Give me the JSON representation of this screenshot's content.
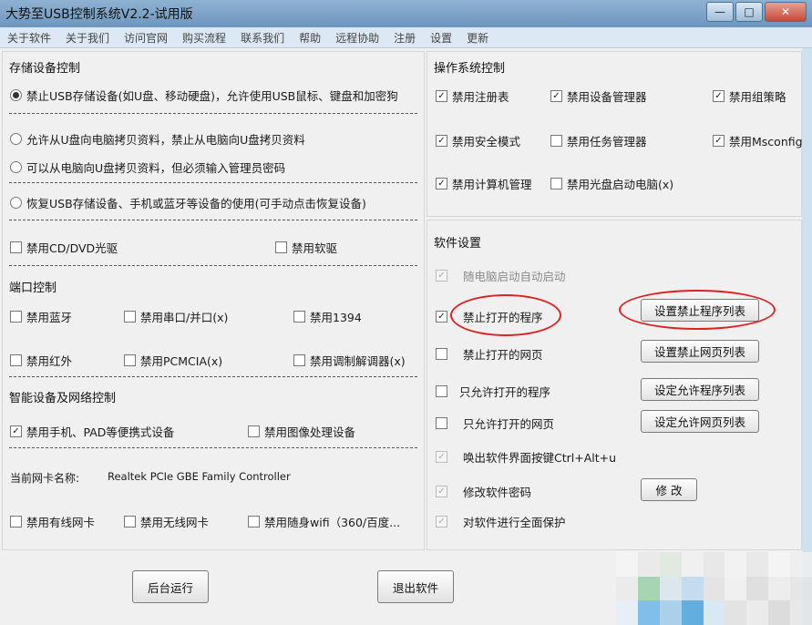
{
  "window": {
    "title": "大势至USB控制系统V2.2-试用版",
    "minimize_glyph": "—",
    "maximize_glyph": "□",
    "close_glyph": "✕"
  },
  "menu": [
    "关于软件",
    "关于我们",
    "访问官网",
    "购买流程",
    "联系我们",
    "帮助",
    "远程协助",
    "注册",
    "设置",
    "更新"
  ],
  "storage": {
    "heading": "存储设备控制",
    "radio_block": "禁止USB存储设备(如U盘、移动硬盘)，允许使用USB鼠标、键盘和加密狗",
    "radio_copy_in": "允许从U盘向电脑拷贝资料，禁止从电脑向U盘拷贝资料",
    "radio_password": "可以从电脑向U盘拷贝资料，但必须输入管理员密码",
    "radio_restore": "恢复USB存储设备、手机或蓝牙等设备的使用(可手动点击恢复设备)",
    "cd_dvd": "禁用CD/DVD光驱",
    "floppy": "禁用软驱"
  },
  "ports": {
    "heading": "端口控制",
    "bluetooth": "禁用蓝牙",
    "serial": "禁用串口/并口(x)",
    "ieee1394": "禁用1394",
    "infrared": "禁用红外",
    "pcmcia": "禁用PCMCIA(x)",
    "modem": "禁用调制解调器(x)"
  },
  "network": {
    "heading": "智能设备及网络控制",
    "portable": "禁用手机、PAD等便携式设备",
    "imaging": "禁用图像处理设备",
    "nic_label": "当前网卡名称:",
    "nic_value": "Realtek PCIe GBE Family Controller",
    "wired": "禁用有线网卡",
    "wireless": "禁用无线网卡",
    "portable_wifi": "禁用随身wifi（360/百度..."
  },
  "os": {
    "heading": "操作系统控制",
    "registry": "禁用注册表",
    "device_manager": "禁用设备管理器",
    "group_policy": "禁用组策略",
    "safe_mode": "禁用安全模式",
    "task_manager": "禁用任务管理器",
    "msconfig": "禁用Msconfig",
    "computer_mgmt": "禁用计算机管理",
    "cd_boot": "禁用光盘启动电脑(x)"
  },
  "software": {
    "heading": "软件设置",
    "autostart": "随电脑启动自动启动",
    "block_programs": "禁止打开的程序",
    "block_programs_btn": "设置禁止程序列表",
    "block_sites": "禁止打开的网页",
    "block_sites_btn": "设置禁止网页列表",
    "allow_programs": "只允许打开的程序",
    "allow_programs_btn": "设定允许程序列表",
    "allow_sites": "只允许打开的网页",
    "allow_sites_btn": "设定允许网页列表",
    "hotkey": "唤出软件界面按键Ctrl+Alt+u",
    "password": "修改软件密码",
    "password_btn": "修 改",
    "protect": "对软件进行全面保护"
  },
  "footer": {
    "background_btn": "后台运行",
    "exit_btn": "退出软件"
  },
  "check_glyph": "✓"
}
